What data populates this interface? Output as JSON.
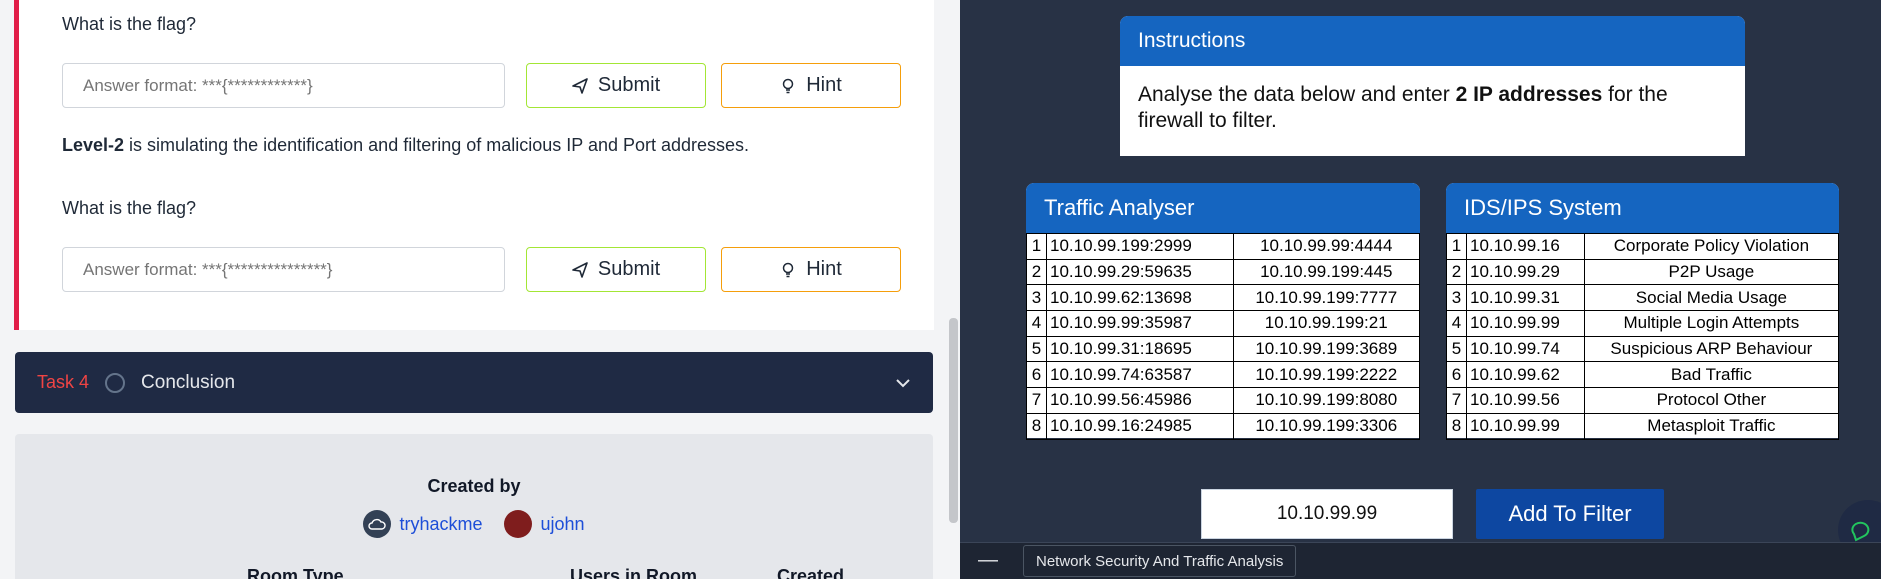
{
  "left": {
    "q1": {
      "label": "What is the flag?",
      "placeholder": "Answer format: ***{************}"
    },
    "level2": {
      "bold": "Level-2",
      "text": " is simulating the identification and filtering of malicious IP and Port addresses."
    },
    "q2": {
      "label": "What is the flag?",
      "placeholder": "Answer format: ***{***************}"
    },
    "submit_label": "Submit",
    "hint_label": "Hint",
    "task": {
      "number": "Task 4",
      "title": "Conclusion"
    },
    "created": {
      "title": "Created by",
      "creators": [
        "tryhackme",
        "ujohn"
      ],
      "meta_labels": [
        "Room Type",
        "Users in Room",
        "Created"
      ]
    }
  },
  "right": {
    "instructions": {
      "title": "Instructions",
      "pre": "Analyse the data below and enter ",
      "bold": "2 IP addresses",
      "post": " for the firewall to filter."
    },
    "analyser": {
      "title": "Traffic Analyser",
      "rows": [
        [
          "1",
          "10.10.99.199:2999",
          "10.10.99.99:4444"
        ],
        [
          "2",
          "10.10.99.29:59635",
          "10.10.99.199:445"
        ],
        [
          "3",
          "10.10.99.62:13698",
          "10.10.99.199:7777"
        ],
        [
          "4",
          "10.10.99.99:35987",
          "10.10.99.199:21"
        ],
        [
          "5",
          "10.10.99.31:18695",
          "10.10.99.199:3689"
        ],
        [
          "6",
          "10.10.99.74:63587",
          "10.10.99.199:2222"
        ],
        [
          "7",
          "10.10.99.56:45986",
          "10.10.99.199:8080"
        ],
        [
          "8",
          "10.10.99.16:24985",
          "10.10.99.199:3306"
        ]
      ]
    },
    "ids": {
      "title": "IDS/IPS System",
      "rows": [
        [
          "1",
          "10.10.99.16",
          "Corporate Policy Violation"
        ],
        [
          "2",
          "10.10.99.29",
          "P2P Usage"
        ],
        [
          "3",
          "10.10.99.31",
          "Social Media Usage"
        ],
        [
          "4",
          "10.10.99.99",
          "Multiple Login Attempts"
        ],
        [
          "5",
          "10.10.99.74",
          "Suspicious ARP Behaviour"
        ],
        [
          "6",
          "10.10.99.62",
          "Bad Traffic"
        ],
        [
          "7",
          "10.10.99.56",
          "Protocol Other"
        ],
        [
          "8",
          "10.10.99.99",
          "Metasploit Traffic"
        ]
      ]
    },
    "filter": {
      "value": "10.10.99.99",
      "button": "Add To Filter"
    },
    "bottom": {
      "minimize": "—",
      "tab_title": "Network Security And Traffic Analysis"
    }
  }
}
